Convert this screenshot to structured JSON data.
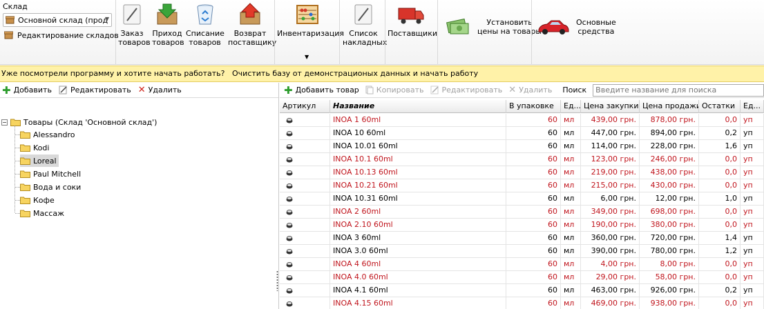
{
  "ribbon": {
    "warehouse_label": "Склад",
    "warehouse_value": "Основной склад (прод",
    "edit_warehouses": "Редактирование складов",
    "buttons": {
      "order": "Заказ\nтоваров",
      "income": "Приход\nтоваров",
      "writeoff": "Списание\nтоваров",
      "return": "Возврат\nпоставщику",
      "inventory": "Инвентаризация",
      "invoices": "Список\nнакладных",
      "suppliers": "Поставщики",
      "set_prices": "Установить\nцены на товары",
      "fixed_assets": "Основные\nсредства"
    }
  },
  "banner": {
    "text": "Уже посмотрели программу и хотите начать работать?",
    "link": "Очистить базу от демонстрационых данных и начать работу"
  },
  "left_toolbar": {
    "add": "Добавить",
    "edit": "Редактировать",
    "delete": "Удалить"
  },
  "tree": {
    "root": "Товары (Склад 'Основной склад')",
    "items": [
      "Alessandro",
      "Kodi",
      "Loreal",
      "Paul Mitchell",
      "Вода и соки",
      "Кофе",
      "Массаж"
    ],
    "selected": "Loreal"
  },
  "right_toolbar": {
    "add": "Добавить товар",
    "copy": "Копировать",
    "edit": "Редактировать",
    "delete": "Удалить",
    "search_label": "Поиск",
    "search_placeholder": "Введите название для поиска"
  },
  "grid": {
    "columns": [
      "Артикул",
      "Название",
      "В упаковке",
      "Ед...",
      "Цена закупки",
      "Цена продажи",
      "Остатки",
      "Ед..."
    ],
    "rows": [
      {
        "name": "INOA 1 60ml",
        "pack": "60",
        "unit": "мл",
        "buy": "439,00 грн.",
        "sell": "878,00 грн.",
        "stock": "0,0",
        "unit2": "уп",
        "red": true
      },
      {
        "name": "INOA 10 60ml",
        "pack": "60",
        "unit": "мл",
        "buy": "447,00 грн.",
        "sell": "894,00 грн.",
        "stock": "0,2",
        "unit2": "уп",
        "red": false
      },
      {
        "name": "INOA 10.01 60ml",
        "pack": "60",
        "unit": "мл",
        "buy": "114,00 грн.",
        "sell": "228,00 грн.",
        "stock": "1,6",
        "unit2": "уп",
        "red": false
      },
      {
        "name": "INOA 10.1 60ml",
        "pack": "60",
        "unit": "мл",
        "buy": "123,00 грн.",
        "sell": "246,00 грн.",
        "stock": "0,0",
        "unit2": "уп",
        "red": true
      },
      {
        "name": "INOA 10.13 60ml",
        "pack": "60",
        "unit": "мл",
        "buy": "219,00 грн.",
        "sell": "438,00 грн.",
        "stock": "0,0",
        "unit2": "уп",
        "red": true
      },
      {
        "name": "INOA 10.21 60ml",
        "pack": "60",
        "unit": "мл",
        "buy": "215,00 грн.",
        "sell": "430,00 грн.",
        "stock": "0,0",
        "unit2": "уп",
        "red": true
      },
      {
        "name": "INOA 10.31 60ml",
        "pack": "60",
        "unit": "мл",
        "buy": "6,00 грн.",
        "sell": "12,00 грн.",
        "stock": "1,0",
        "unit2": "уп",
        "red": false
      },
      {
        "name": "INOA 2 60ml",
        "pack": "60",
        "unit": "мл",
        "buy": "349,00 грн.",
        "sell": "698,00 грн.",
        "stock": "0,0",
        "unit2": "уп",
        "red": true
      },
      {
        "name": "INOA 2.10 60ml",
        "pack": "60",
        "unit": "мл",
        "buy": "190,00 грн.",
        "sell": "380,00 грн.",
        "stock": "0,0",
        "unit2": "уп",
        "red": true
      },
      {
        "name": "INOA 3 60ml",
        "pack": "60",
        "unit": "мл",
        "buy": "360,00 грн.",
        "sell": "720,00 грн.",
        "stock": "1,4",
        "unit2": "уп",
        "red": false
      },
      {
        "name": "INOA 3.0 60ml",
        "pack": "60",
        "unit": "мл",
        "buy": "390,00 грн.",
        "sell": "780,00 грн.",
        "stock": "1,2",
        "unit2": "уп",
        "red": false
      },
      {
        "name": "INOA 4 60ml",
        "pack": "60",
        "unit": "мл",
        "buy": "4,00 грн.",
        "sell": "8,00 грн.",
        "stock": "0,0",
        "unit2": "уп",
        "red": true
      },
      {
        "name": "INOA 4.0 60ml",
        "pack": "60",
        "unit": "мл",
        "buy": "29,00 грн.",
        "sell": "58,00 грн.",
        "stock": "0,0",
        "unit2": "уп",
        "red": true
      },
      {
        "name": "INOA 4.1 60ml",
        "pack": "60",
        "unit": "мл",
        "buy": "463,00 грн.",
        "sell": "926,00 грн.",
        "stock": "0,2",
        "unit2": "уп",
        "red": false
      },
      {
        "name": "INOA 4.15 60ml",
        "pack": "60",
        "unit": "мл",
        "buy": "469,00 грн.",
        "sell": "938,00 грн.",
        "stock": "0,0",
        "unit2": "уп",
        "red": true
      }
    ]
  },
  "colors": {
    "banner_bg": "#fff2a8",
    "zero_stock_text": "#c0141c",
    "selected_tree": "#d9d9d9"
  }
}
